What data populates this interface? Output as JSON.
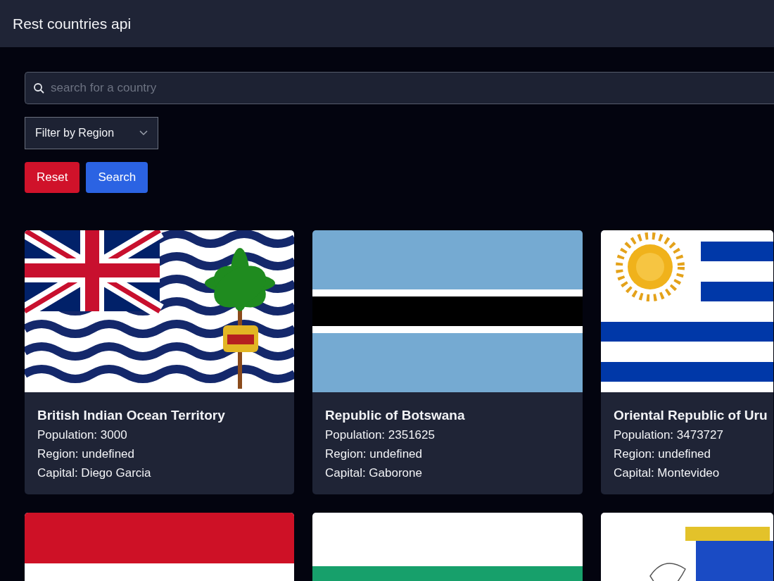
{
  "header": {
    "title": "Rest countries api"
  },
  "search": {
    "placeholder": "search for a country"
  },
  "filter": {
    "label": "Filter by Region"
  },
  "buttons": [
    {
      "kind": "reset",
      "label": "Reset"
    },
    {
      "kind": "search",
      "label": "Search"
    }
  ],
  "cards": [
    {
      "kind": "full",
      "name": "British Indian Ocean Territory",
      "population": "Population: 3000",
      "region": "Region: undefined",
      "capital": "Capital: Diego Garcia"
    },
    {
      "kind": "full",
      "name": "Republic of Botswana",
      "population": "Population: 2351625",
      "region": "Region: undefined",
      "capital": "Capital: Gaborone"
    },
    {
      "kind": "full",
      "name": "Oriental Republic of Uru",
      "population": "Population: 3473727",
      "region": "Region: undefined",
      "capital": "Capital: Montevideo"
    },
    {
      "kind": "flag_only"
    },
    {
      "kind": "flag_only"
    },
    {
      "kind": "flag_only"
    }
  ]
}
